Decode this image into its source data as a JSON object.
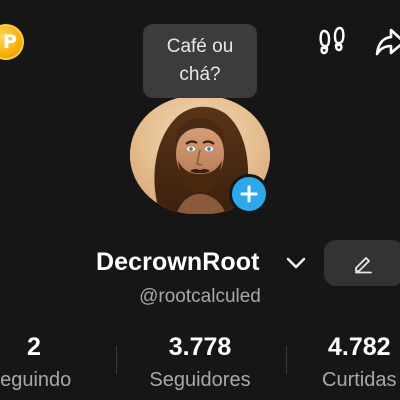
{
  "bubble": {
    "text": "Café ou\nchá?"
  },
  "profile": {
    "username": "DecrownRoot",
    "handle": "@rootcalculed"
  },
  "stats": [
    {
      "value": "2",
      "label": "Seguindo"
    },
    {
      "value": "3.778",
      "label": "Seguidores"
    },
    {
      "value": "4.782",
      "label": "Curtidas"
    }
  ],
  "icons": {
    "coin": "coin-icon",
    "coin_letter": "P",
    "footprints": "footprints-icon",
    "share": "share-icon",
    "add": "plus-icon",
    "chevron": "chevron-down-icon",
    "edit": "pencil-icon"
  },
  "colors": {
    "background": "#161616",
    "coin": "#f7a900",
    "add_badge": "#2da8e8",
    "muted_text": "#a8a8a8",
    "button_bg": "#333333"
  }
}
